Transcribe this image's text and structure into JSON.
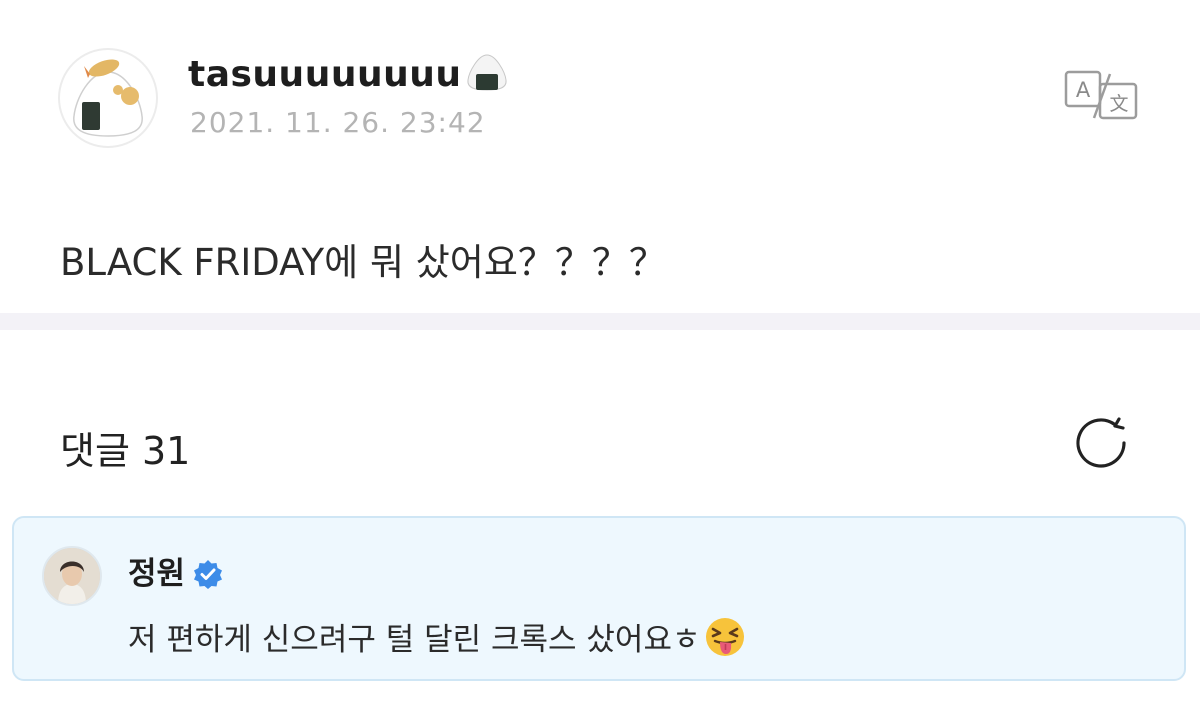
{
  "post": {
    "author": "tasuuuuuuuu",
    "author_icon": "onigiri-icon",
    "timestamp": "2021. 11. 26. 23:42",
    "translate_icon": "translate-icon",
    "body": "BLACK FRIDAY에 뭐 샀어요？？？？"
  },
  "comments": {
    "title": "댓글 31",
    "refresh_icon": "refresh-icon",
    "items": [
      {
        "name": "정원",
        "verified": true,
        "text": "저 편하게 신으려구 털 달린 크록스 샀어요ㅎ",
        "emoji": "squinting-face-with-tongue"
      }
    ]
  },
  "colors": {
    "text": "#222222",
    "timestamp": "#b4b4b4",
    "divider": "#f3f2f7",
    "comment_bg": "#eef8fe",
    "comment_border": "#cfe6f5",
    "verified": "#3d8ce8"
  }
}
